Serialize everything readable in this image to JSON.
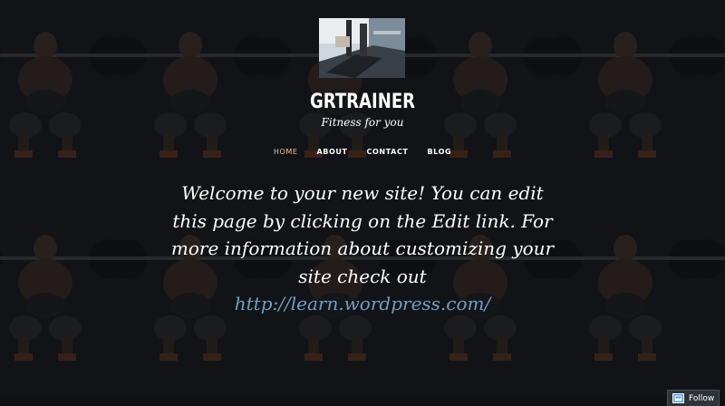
{
  "site": {
    "title": "GRTRAINER",
    "tagline": "Fitness for you"
  },
  "nav": {
    "items": [
      {
        "label": "HOME",
        "current": true
      },
      {
        "label": "ABOUT",
        "current": false
      },
      {
        "label": "CONTACT",
        "current": false
      },
      {
        "label": "BLOG",
        "current": false
      }
    ]
  },
  "content": {
    "text": "Welcome to your new site! You can edit this page by clicking on the Edit link. For more information about customizing your site check out",
    "link": "http://learn.wordpress.com/"
  },
  "follow": {
    "label": "Follow",
    "icon": "follow-icon"
  },
  "colors": {
    "background": "#141518",
    "text": "#ffffff",
    "nav_current": "#e8c9a8",
    "link": "#6f9ec4",
    "follow_bg": "#2e3338"
  }
}
